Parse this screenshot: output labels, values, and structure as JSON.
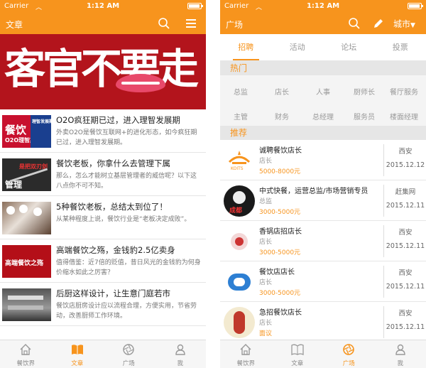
{
  "left": {
    "status": {
      "carrier": "Carrier",
      "time": "1:12 AM"
    },
    "nav": {
      "title": "文章"
    },
    "banner": {
      "text": "客官不要走"
    },
    "articles": [
      {
        "title": "O2O疯狂期已过，进入理智发展期",
        "desc": "外卖O2O是餐饮互联网+的进化形态，如今疯狂期已过，进入理智发展期。",
        "thumb_text": "餐饮",
        "thumb_sub": "O2O理智期",
        "thumb_badge": "理智发展期"
      },
      {
        "title": "餐饮老板，你拿什么去管理下属",
        "desc": "那么，怎么才能树立基层管理者的威信呢？以下这八点你不可不知。",
        "thumb_text": "管理",
        "thumb_sub": "是把双刃剑"
      },
      {
        "title": "5种餐饮老板，总结太到位了！",
        "desc": "从某种程度上说，餐饮行业是“老板决定成败”。",
        "thumb_text": ""
      },
      {
        "title": "高端餐饮之殇，金钱豹2.5亿卖身",
        "desc": "值得借鉴：近7倍的贬值，昔日风光的金钱豹为何身价缩水如此之厉害？",
        "thumb_text": "高端餐饮之殇"
      },
      {
        "title": "后厨这样设计，让生意门庭若市",
        "desc": "餐饮店厨房设计应以流程合理，方便实用，节省劳动，改善厨师工作环境。",
        "thumb_text": ""
      }
    ],
    "tabs": [
      {
        "label": "餐饮界"
      },
      {
        "label": "文章"
      },
      {
        "label": "广场"
      },
      {
        "label": "我"
      }
    ]
  },
  "right": {
    "status": {
      "carrier": "Carrier",
      "time": "1:12 AM"
    },
    "nav": {
      "title": "广场",
      "city": "城市"
    },
    "subtabs": [
      {
        "label": "招聘"
      },
      {
        "label": "活动"
      },
      {
        "label": "论坛"
      },
      {
        "label": "投票"
      }
    ],
    "hot_header": "热门",
    "hot": [
      "总监",
      "店长",
      "人事",
      "厨师长",
      "餐厅服务",
      "主管",
      "财务",
      "总经理",
      "服务员",
      "楼面经理"
    ],
    "rec_header": "推荐",
    "jobs": [
      {
        "title": "诚聘餐饮店长",
        "position": "店长",
        "salary": "5000-8000元",
        "city": "西安",
        "date": "2015.12.12",
        "logo_text": "KOITS"
      },
      {
        "title": "中式快餐，运营总监/市场营销专员",
        "position": "总监",
        "salary": "3000-5000元",
        "city": "赶集网",
        "date": "2015.12.11",
        "logo_text": "成都"
      },
      {
        "title": "香锅店招店长",
        "position": "店长",
        "salary": "3000-5000元",
        "city": "西安",
        "date": "2015.12.11",
        "logo_text": ""
      },
      {
        "title": "餐饮店店长",
        "position": "店长",
        "salary": "3000-5000元",
        "city": "西安",
        "date": "2015.12.11",
        "logo_text": ""
      },
      {
        "title": "急招餐饮店长",
        "position": "店长",
        "salary": "面议",
        "city": "西安",
        "date": "2015.12.11",
        "logo_text": ""
      }
    ],
    "tabs": [
      {
        "label": "餐饮界"
      },
      {
        "label": "文章"
      },
      {
        "label": "广场"
      },
      {
        "label": "我"
      }
    ]
  },
  "colors": {
    "accent": "#f7941d",
    "banner": "#b3141c"
  }
}
